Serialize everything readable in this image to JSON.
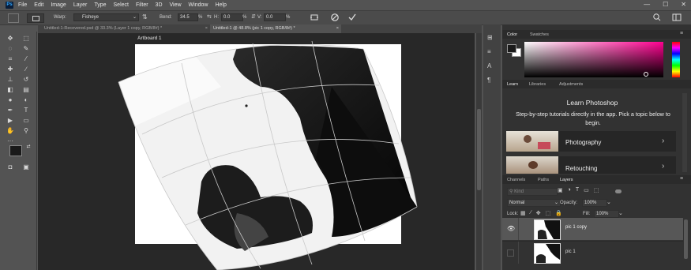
{
  "app": {
    "logo": "Ps"
  },
  "menu": [
    "File",
    "Edit",
    "Image",
    "Layer",
    "Type",
    "Select",
    "Filter",
    "3D",
    "View",
    "Window",
    "Help"
  ],
  "options": {
    "warp_label": "Warp:",
    "warp_value": "Fisheye",
    "bend_label": "Bend:",
    "bend_value": "34.5",
    "pct": "%",
    "h_label": "H:",
    "h_value": "0.0",
    "v_label": "V:",
    "v_value": "0.0"
  },
  "tabs": [
    {
      "label": "Untitled-1-Recovered.psd @ 33.3% (Layer 1 copy, RGB/8#) *",
      "active": false
    },
    {
      "label": "Untitled-1 @ 48.8% (pic 1 copy, RGB/8#) *",
      "active": true
    }
  ],
  "artboard": {
    "label": "Artboard 1"
  },
  "color_panel": {
    "tabs": [
      "Color",
      "Swatches"
    ],
    "colors": {
      "foreground": "#1a1a1a",
      "background": "#ffffff",
      "hue": "#ff0090"
    }
  },
  "learn_panel": {
    "tabs": [
      "Learn",
      "Libraries",
      "Adjustments"
    ],
    "title": "Learn Photoshop",
    "subtitle": "Step-by-step tutorials directly in the app. Pick a topic below to begin.",
    "cards": [
      {
        "label": "Photography",
        "icon": "chevron-right-icon"
      },
      {
        "label": "Retouching",
        "icon": "chevron-right-icon"
      }
    ]
  },
  "layers_panel": {
    "tabs": [
      "Channels",
      "Paths",
      "Layers"
    ],
    "search_placeholder": "Kind",
    "blend_mode": "Normal",
    "opacity_label": "Opacity:",
    "opacity_value": "100%",
    "lock_label": "Lock:",
    "fill_label": "Fill:",
    "fill_value": "100%",
    "layers": [
      {
        "name": "pic 1 copy",
        "visible": true,
        "selected": true
      },
      {
        "name": "pic 1",
        "visible": false,
        "selected": false
      }
    ]
  }
}
